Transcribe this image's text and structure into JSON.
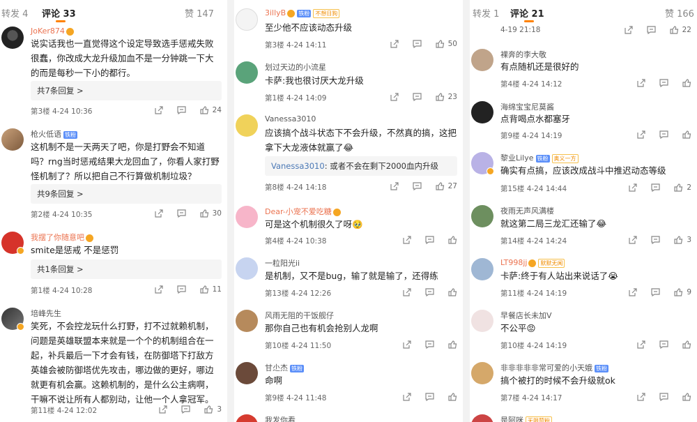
{
  "panel1": {
    "tabs": {
      "repost": "转发 4",
      "comments": "评论 33",
      "likes": "赞 147"
    },
    "replies_1": "共7条回复 >",
    "replies_2": "共9条回复 >",
    "replies_3": "共1条回复 >",
    "comments": [
      {
        "name": "JoKer874",
        "text": "说实话我也一直觉得这个设定导致选手惩戒失败很蠢，你改成大龙升级加血不是一分钟跳一下大的而是每秒一下小的都行。",
        "meta": "第3楼  4-24 10:36",
        "likes": "24"
      },
      {
        "name": "枪火低语",
        "badge": "铁粉",
        "text": "这机制不是一天两天了吧，你是打野会不知道吗？rng当时惩戒结果大龙回血了，你看人家打野怪机制了？所以把自己不行算做机制垃圾？",
        "meta": "第2楼  4-24 10:35",
        "likes": "30"
      },
      {
        "name": "我摆了你随意吧",
        "text": "smite是惩戒 不是惩罚",
        "meta": "第1楼  4-24 10:28",
        "likes": "11"
      },
      {
        "name": "培峰先生",
        "text": "笑死，不会控龙玩什么打野，打不过就赖机制，问题是英雄联盟本来就是一个个的机制组合在一起，补兵最后一下才会有钱，在防御塔下打敌方英雄会被防御塔优先攻击，哪边做的更好，哪边就更有机会赢。这赖机制的，是什么公主病啊，干嘛不说让所有人都别动，让他一个人拿冠军。",
        "meta": "第11楼  4-24 12:02",
        "likes": "3"
      }
    ]
  },
  "panel2": {
    "comments": [
      {
        "name": "3illyB",
        "badge": "铁粉",
        "badge2": "不想日狗",
        "text": "至少他不应该动态升级",
        "meta": "第3楼  4-24 14:11",
        "likes": "50"
      },
      {
        "name": "划过天边的小流星",
        "text": "卡萨:我也很讨厌大龙升级",
        "meta": "第1楼  4-24 14:09",
        "likes": "23"
      },
      {
        "name": "Vanessa3010",
        "text": "应该搞个战斗状态下不会升级，不然真的搞，这把拿下大龙液体就赢了😂",
        "quote_name": "Vanessa3010",
        "quote_text": ": 或者不会在剩下2000血内升级",
        "meta": "第8楼  4-24 14:18",
        "likes": "27"
      },
      {
        "name": "Dear-小宠不爱吃糖",
        "text": "可是这个机制很久了呀🥹",
        "meta": "第4楼  4-24 10:38",
        "likes": ""
      },
      {
        "name": "一粒阳光ii",
        "text": "是机制，又不是bug，输了就是输了，还得练",
        "meta": "第13楼  4-24 12:26",
        "likes": ""
      },
      {
        "name": "风雨无阻的干饭舰仔",
        "text": "那你自己也有机会抢别人龙啊",
        "meta": "第10楼  4-24 11:50",
        "likes": ""
      },
      {
        "name": "甘尐杰",
        "badge": "铁粉",
        "text": "命啊",
        "meta": "第9楼  4-24 11:48",
        "likes": ""
      },
      {
        "name": "我发你看",
        "text": "",
        "meta": "",
        "likes": ""
      }
    ]
  },
  "panel3": {
    "tabs": {
      "repost": "转发 1",
      "comments": "评论 21",
      "likes": "赞 166"
    },
    "top_meta": "4-19 21:18",
    "top_likes": "22",
    "comments": [
      {
        "name": "裸奔的李大敬",
        "text": "有点随机还是很好的",
        "meta": "第4楼  4-24 14:12",
        "likes": ""
      },
      {
        "name": "海绵宝宝尼莫酱",
        "text": "点背喝点水都塞牙",
        "meta": "第9楼  4-24 14:19",
        "likes": ""
      },
      {
        "name": "黎业Lilye",
        "badge": "铁粉",
        "badge2": "奥义一方",
        "text": "确实有点搞，应该改成战斗中推迟动态等级",
        "meta": "第15楼  4-24 14:44",
        "likes": "2"
      },
      {
        "name": "夜雨无声风满楼",
        "text": "就这第二局三龙汇还输了😂",
        "meta": "第14楼  4-24 14:24",
        "likes": "3"
      },
      {
        "name": "LT998jj",
        "badge2": "默默无闻",
        "text": "卡萨:终于有人站出来说话了😭",
        "meta": "第11楼  4-24 14:19",
        "likes": "9"
      },
      {
        "name": "早餐店长未加V",
        "text": "不公平😡",
        "meta": "第10楼  4-24 14:19",
        "likes": ""
      },
      {
        "name": "非非非非非常可爱的小天娥",
        "badge": "铁粉",
        "text": "搞个被打的时候不会升级就ok",
        "meta": "第7楼  4-24 14:17",
        "likes": ""
      },
      {
        "name": "是阿咪",
        "badge2": "无限赞粉",
        "text": "",
        "meta": "",
        "likes": ""
      }
    ]
  }
}
